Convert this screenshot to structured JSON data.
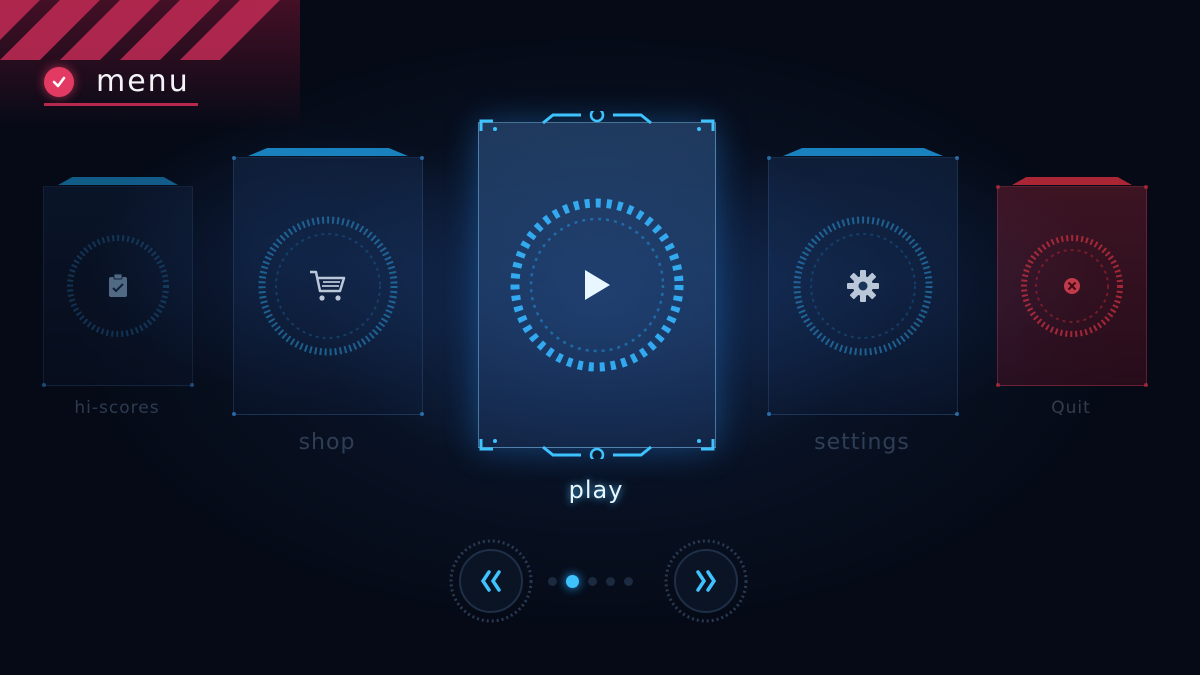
{
  "header": {
    "title": "menu"
  },
  "menu_items": {
    "hiscores": {
      "label": "hi-scores",
      "icon": "clipboard-icon"
    },
    "shop": {
      "label": "shop",
      "icon": "cart-icon"
    },
    "play": {
      "label": "play",
      "icon": "play-icon"
    },
    "settings": {
      "label": "settings",
      "icon": "gear-icon"
    },
    "quit": {
      "label": "Quit",
      "icon": "close-icon"
    }
  },
  "pager": {
    "pages": 5,
    "active_index": 1
  },
  "colors": {
    "accent": "#2aa8ff",
    "danger": "#e23040",
    "header_accent": "#e23a62"
  }
}
